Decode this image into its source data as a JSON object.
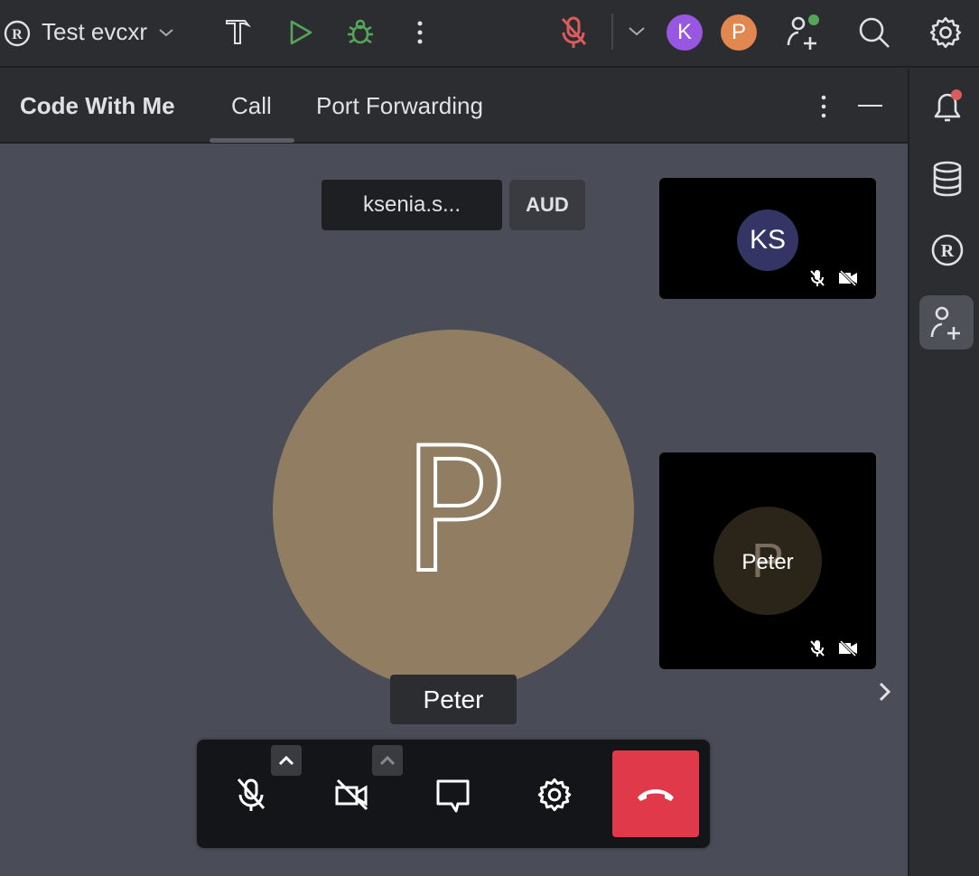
{
  "toolbar": {
    "project_name": "Test evcxr",
    "avatars": [
      {
        "initial": "K",
        "color": "#9857e0"
      },
      {
        "initial": "P",
        "color": "#e0884f"
      }
    ]
  },
  "panel": {
    "title": "Code With Me",
    "tabs": [
      {
        "label": "Call",
        "active": true
      },
      {
        "label": "Port Forwarding",
        "active": false
      }
    ]
  },
  "call": {
    "speaker_name": "ksenia.s...",
    "audio_badge": "AUD",
    "main_participant": {
      "initial": "P",
      "name": "Peter",
      "color": "#917e62"
    },
    "tiles": [
      {
        "initials": "KS",
        "color": "#353565",
        "mic_muted": true,
        "camera_off": true
      },
      {
        "initials": "P",
        "name": "Peter",
        "color": "#2b2419",
        "mic_muted": true,
        "camera_off": true
      }
    ]
  },
  "colors": {
    "accent_green": "#57a55a",
    "mute_red": "#db5c5c",
    "hangup": "#e0394a"
  }
}
